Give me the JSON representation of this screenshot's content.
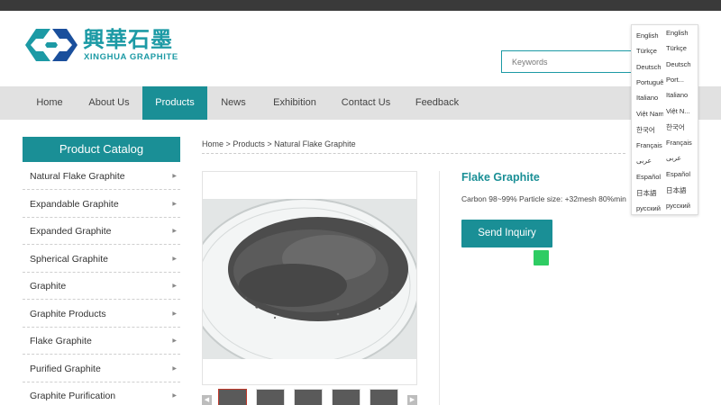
{
  "logo": {
    "cn": "興華石墨",
    "en": "XINGHUA GRAPHITE"
  },
  "search": {
    "placeholder": "Keywords"
  },
  "nav": [
    {
      "label": "Home"
    },
    {
      "label": "About Us"
    },
    {
      "label": "Products",
      "active": true
    },
    {
      "label": "News"
    },
    {
      "label": "Exhibition"
    },
    {
      "label": "Contact Us"
    },
    {
      "label": "Feedback"
    }
  ],
  "languages": [
    {
      "a": "English",
      "b": "English"
    },
    {
      "a": "Türkçe",
      "b": "Türkçe"
    },
    {
      "a": "Deutsch",
      "b": "Deutsch"
    },
    {
      "a": "Português",
      "b": "Port..."
    },
    {
      "a": "Italiano",
      "b": "Italiano"
    },
    {
      "a": "Việt Nam",
      "b": "Việt N..."
    },
    {
      "a": "한국어",
      "b": "한국어"
    },
    {
      "a": "Français",
      "b": "Français"
    },
    {
      "a": "عربى",
      "b": "عربى"
    },
    {
      "a": "Español",
      "b": "Español"
    },
    {
      "a": "日本語",
      "b": "日本語"
    },
    {
      "a": "русский",
      "b": "русский"
    }
  ],
  "catalog": {
    "title": "Product Catalog",
    "items": [
      "Natural Flake Graphite",
      "Expandable Graphite",
      "Expanded Graphite",
      "Spherical Graphite",
      "Graphite",
      "Graphite Products",
      "Flake Graphite",
      "Purified Graphite",
      "Graphite Purification"
    ]
  },
  "breadcrumb": {
    "home": "Home",
    "sep": ">",
    "products": "Products",
    "current": "Natural Flake Graphite"
  },
  "product": {
    "title": "Flake Graphite",
    "description": "Carbon 98~99% Particle size: +32mesh 80%min",
    "inquiry_label": "Send Inquiry"
  },
  "thumbnails": {
    "count": 5,
    "selected": 0
  },
  "colors": {
    "brand": "#1a8f96",
    "nav_bg": "#e1e1e1",
    "chat": "#2ecc63"
  },
  "icons": [
    "chevron-right-icon",
    "arrow-left-icon",
    "arrow-right-icon",
    "chat-icon"
  ]
}
